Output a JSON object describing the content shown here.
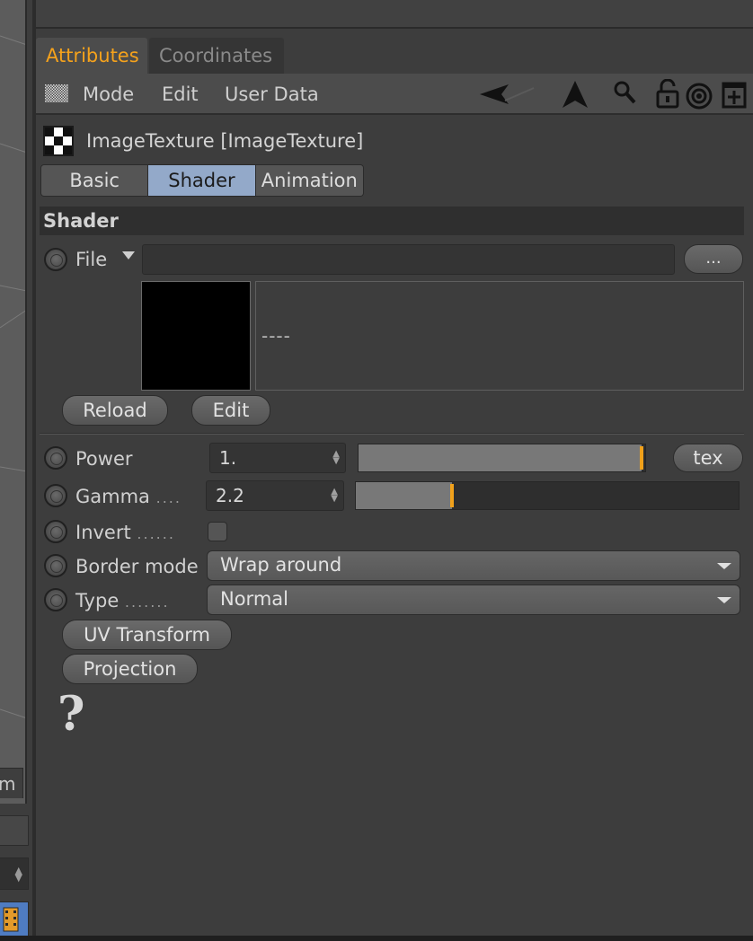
{
  "viewport": {
    "tab_label": "m"
  },
  "tabs": [
    {
      "label": "Attributes",
      "active": true
    },
    {
      "label": "Coordinates",
      "active": false
    }
  ],
  "menu": {
    "mode": "Mode",
    "edit": "Edit",
    "user_data": "User Data"
  },
  "toolbar_icons": [
    "back-arrow-icon",
    "up-arrow-icon",
    "search-icon",
    "lock-icon",
    "target-icon",
    "new-panel-icon"
  ],
  "object": {
    "title": "ImageTexture [ImageTexture]",
    "icon": "checker-icon"
  },
  "subtabs": [
    {
      "label": "Basic",
      "active": false
    },
    {
      "label": "Shader",
      "active": true
    },
    {
      "label": "Animation",
      "active": false
    }
  ],
  "section": {
    "title": "Shader"
  },
  "file": {
    "label": "File",
    "value": "",
    "browse_label": "...",
    "info_text": "----"
  },
  "buttons": {
    "reload": "Reload",
    "edit": "Edit",
    "tex": "tex",
    "uv_transform": "UV Transform",
    "projection": "Projection"
  },
  "params": {
    "power": {
      "label": "Power",
      "value": "1.",
      "slider_fraction": 1.0
    },
    "gamma": {
      "label": "Gamma",
      "dots": "....",
      "value": "2.2",
      "slider_fraction": 0.26
    },
    "invert": {
      "label": "Invert",
      "dots": "......",
      "checked": false
    },
    "border_mode": {
      "label": "Border mode",
      "value": "Wrap around"
    },
    "type": {
      "label": "Type",
      "dots": ".......",
      "value": "Normal"
    }
  },
  "help": {
    "symbol": "?"
  },
  "colors": {
    "accent": "#f5a21c",
    "active_subtab": "#93a9c9",
    "slider_marker": "#f0a11b"
  }
}
